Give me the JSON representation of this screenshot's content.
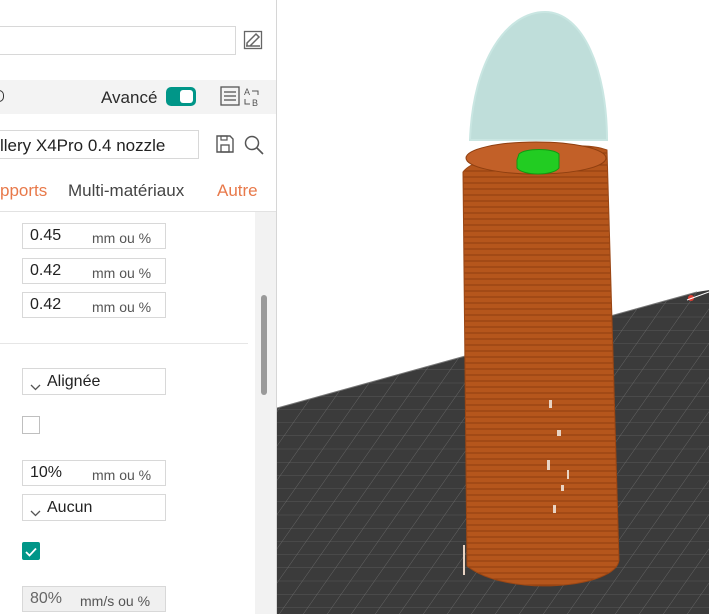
{
  "header": {
    "advanced_label": "Avancé",
    "advanced_on": true,
    "printer_preset": "llery X4Pro 0.4 nozzle"
  },
  "tabs": [
    {
      "label": "pports",
      "active": true
    },
    {
      "label": "Multi-matériaux",
      "active": false
    },
    {
      "label": "Autre",
      "active": false
    }
  ],
  "fields": {
    "line_width_1": {
      "value": "0.45",
      "unit": "mm ou %"
    },
    "line_width_2": {
      "value": "0.42",
      "unit": "mm ou %"
    },
    "line_width_3": {
      "value": "0.42",
      "unit": "mm ou %"
    },
    "pattern_select": {
      "value": "Alignée"
    },
    "checkbox_1": {
      "checked": false
    },
    "percent_field": {
      "value": "10%",
      "unit": "mm ou %"
    },
    "ironing_select": {
      "value": "Aucun"
    },
    "checkbox_2": {
      "checked": true
    },
    "speed_field": {
      "value": "80%",
      "unit": "mm/s ou %"
    }
  },
  "colors": {
    "accent": "#009688",
    "tab_active": "#e8794a",
    "model_orange": "#b5561c",
    "bed_dark": "#3a3a3a",
    "support_green": "#22cc22",
    "translucent_cap": "#9fcfc9"
  },
  "icons": [
    "edit-icon",
    "toggle-switch-icon",
    "list-compare-icon",
    "save-icon",
    "search-icon",
    "chevron-down-icon",
    "check-icon"
  ]
}
